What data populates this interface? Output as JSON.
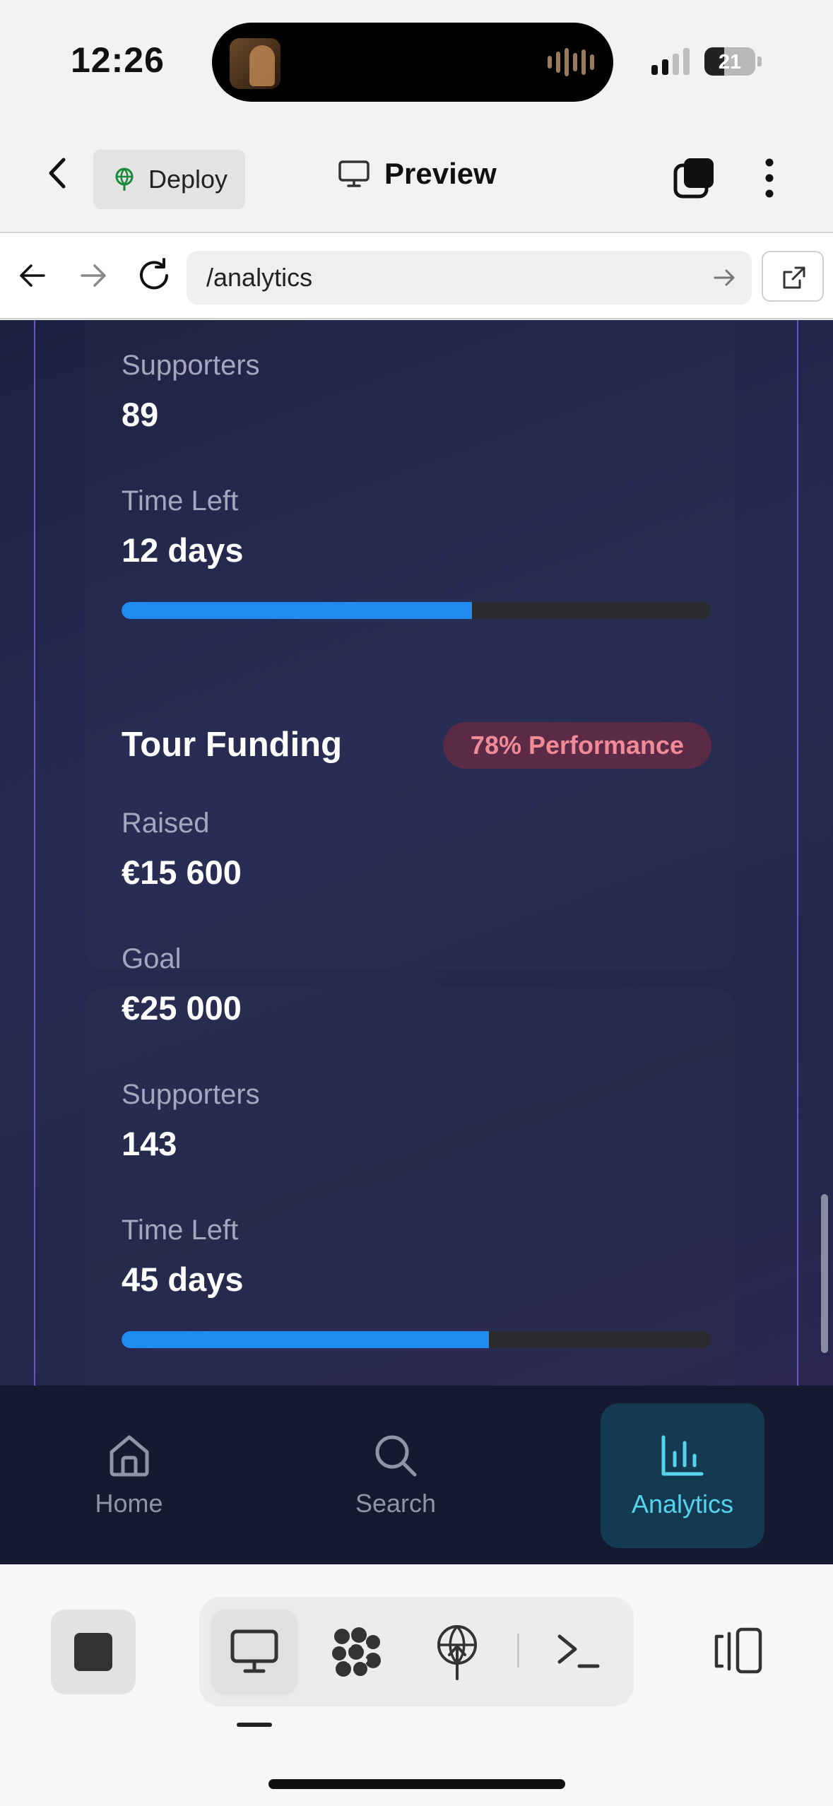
{
  "status_bar": {
    "time": "12:26",
    "battery": "21"
  },
  "toolbar": {
    "deploy_label": "Deploy",
    "preview_label": "Preview"
  },
  "url_bar": {
    "url": "/analytics"
  },
  "campaign_top": {
    "supporters_label": "Supporters",
    "supporters_value": "89",
    "time_left_label": "Time Left",
    "time_left_value": "12 days",
    "progress_fraction": 0.595
  },
  "campaign_tour": {
    "title": "Tour Funding",
    "badge": "78% Performance",
    "raised_label": "Raised",
    "raised_value": "€15 600",
    "goal_label": "Goal",
    "goal_value": "€25 000",
    "supporters_label": "Supporters",
    "supporters_value": "143",
    "time_left_label": "Time Left",
    "time_left_value": "45 days",
    "progress_fraction": 0.624
  },
  "bottom_nav": {
    "items": [
      {
        "label": "Home",
        "icon": "home-icon"
      },
      {
        "label": "Search",
        "icon": "search-icon"
      },
      {
        "label": "Analytics",
        "icon": "bar-chart-icon",
        "active": true
      }
    ]
  },
  "colors": {
    "accent": "#1f8af0",
    "active_nav_text": "#56d4ee",
    "badge_text": "#f08a96",
    "badge_bg": "#5a2a46"
  }
}
